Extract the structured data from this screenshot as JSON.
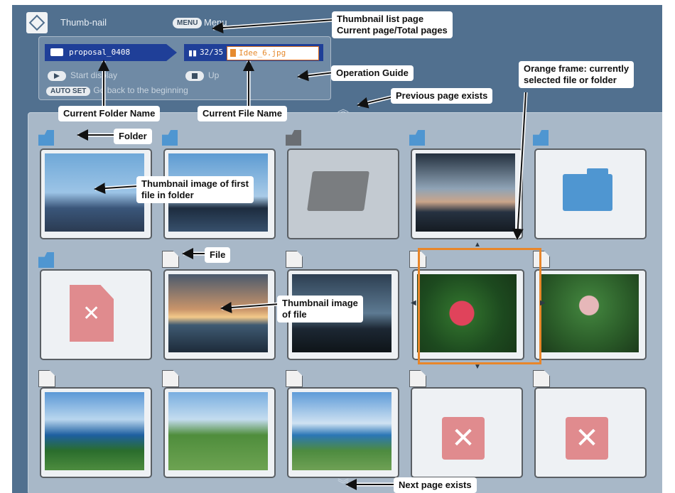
{
  "header": {
    "title": "Thumb-nail",
    "menu_key": "MENU",
    "menu_label": "Menu"
  },
  "info_panel": {
    "folder_name": "proposal_0408",
    "page_indicator": "32/35",
    "file_name": "Idee_6.jpg",
    "guide": {
      "display_label": "Start display",
      "up_label": "Up",
      "autoset_key": "AUTO SET",
      "autoset_label": "Go back to the beginning"
    }
  },
  "callouts": {
    "thumbnail_list_page": "Thumbnail list page",
    "current_total_pages": "Current page/Total pages",
    "operation_guide": "Operation Guide",
    "current_folder_name": "Current Folder Name",
    "current_file_name": "Current File Name",
    "previous_page_exists": "Previous page exists",
    "orange_frame_1": "Orange frame: currently",
    "orange_frame_2": "selected file or folder",
    "folder": "Folder",
    "thumb_first_1": "Thumbnail image of first",
    "thumb_first_2": "file in folder",
    "file": "File",
    "thumb_file_1": "Thumbnail image",
    "thumb_file_2": "of file",
    "next_page_exists": "Next page exists"
  },
  "colors": {
    "screen_bg": "#51708f",
    "panel_bg": "#a8b8c8",
    "selection_frame": "#e8862a",
    "folder_blue": "#4f96d1",
    "error_red": "#e08b8e"
  },
  "icons": [
    "app-logo-icon",
    "folder-icon",
    "file-icon",
    "book-icon",
    "chevron-up-icon",
    "chevron-down-icon",
    "error-icon"
  ]
}
